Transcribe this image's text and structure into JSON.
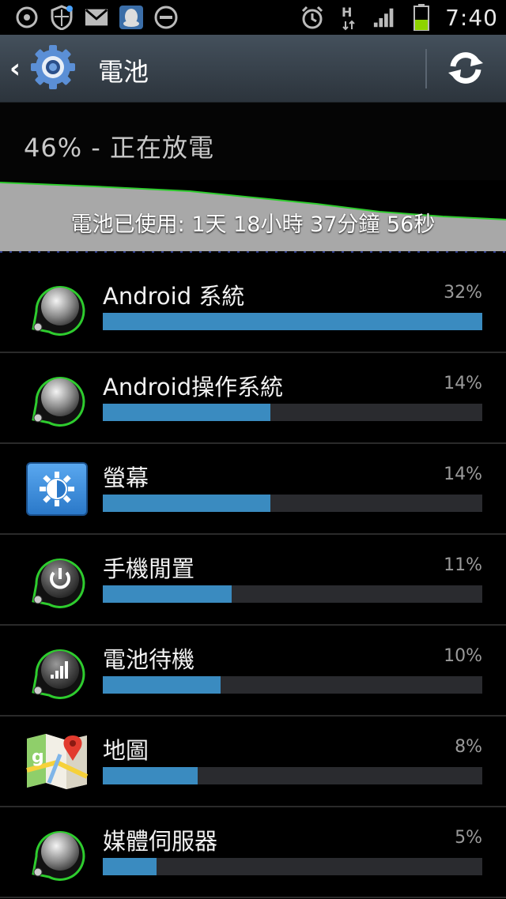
{
  "status_bar": {
    "time": "7:40",
    "icons": [
      "sync-icon",
      "shield-icon",
      "gmail-icon",
      "qq-icon",
      "do-not-disturb-icon",
      "alarm-icon",
      "h-network-icon",
      "signal-icon",
      "battery-icon"
    ],
    "network_label": "H"
  },
  "header": {
    "title": "電池",
    "back_icon": "chevron-left-icon",
    "app_icon": "settings-gear-icon",
    "refresh_icon": "refresh-icon"
  },
  "battery": {
    "status": "46% - 正在放電",
    "usage": "電池已使用: 1天 18小時 37分鐘 56秒",
    "level_fraction": 0.46
  },
  "items": [
    {
      "name": "Android 系統",
      "percent_label": "32%",
      "fraction": 1.0,
      "icon": "android-system-icon"
    },
    {
      "name": "Android操作系統",
      "percent_label": "14%",
      "fraction": 0.4417,
      "icon": "android-os-icon"
    },
    {
      "name": "螢幕",
      "percent_label": "14%",
      "fraction": 0.4417,
      "icon": "screen-brightness-icon"
    },
    {
      "name": "手機閒置",
      "percent_label": "11%",
      "fraction": 0.3396,
      "icon": "phone-idle-power-icon"
    },
    {
      "name": "電池待機",
      "percent_label": "10%",
      "fraction": 0.3104,
      "icon": "cell-standby-signal-icon"
    },
    {
      "name": "地圖",
      "percent_label": "8%",
      "fraction": 0.25,
      "icon": "maps-icon"
    },
    {
      "name": "媒體伺服器",
      "percent_label": "5%",
      "fraction": 0.1417,
      "icon": "media-server-icon"
    }
  ],
  "colors": {
    "bar_fill": "#3a8bc0",
    "bar_track": "#2a2b2f",
    "graph_line": "#2ecc2e",
    "graph_fill": "#a8a8a8",
    "ring_green": "#2ecc2e"
  }
}
